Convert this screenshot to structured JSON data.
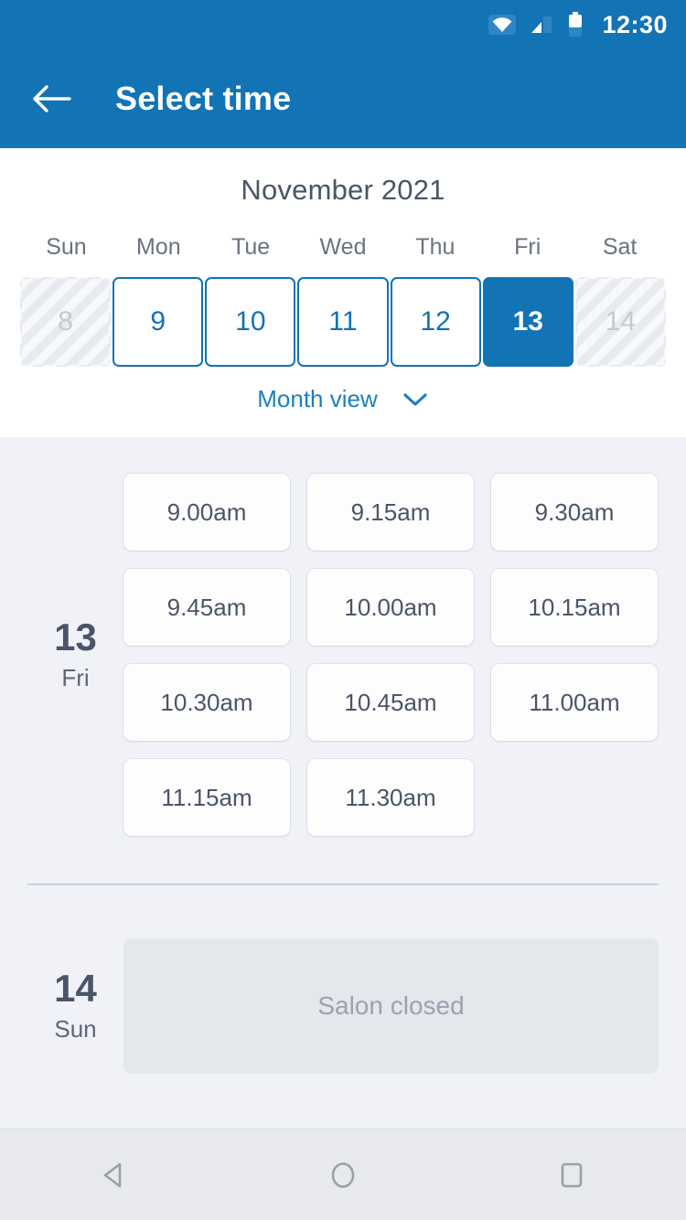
{
  "status_bar": {
    "time": "12:30",
    "icons": [
      "wifi-icon",
      "signal-icon",
      "battery-icon"
    ]
  },
  "app_bar": {
    "back_icon": "back-arrow-icon",
    "title": "Select time"
  },
  "calendar": {
    "month_title": "November 2021",
    "weekdays": [
      "Sun",
      "Mon",
      "Tue",
      "Wed",
      "Thu",
      "Fri",
      "Sat"
    ],
    "days": [
      {
        "number": "8",
        "state": "disabled"
      },
      {
        "number": "9",
        "state": "available"
      },
      {
        "number": "10",
        "state": "available"
      },
      {
        "number": "11",
        "state": "available"
      },
      {
        "number": "12",
        "state": "available"
      },
      {
        "number": "13",
        "state": "selected"
      },
      {
        "number": "14",
        "state": "disabled"
      }
    ],
    "month_view_label": "Month view",
    "month_view_icon": "chevron-down-icon"
  },
  "schedule": [
    {
      "day_number": "13",
      "day_of_week": "Fri",
      "slots": [
        "9.00am",
        "9.15am",
        "9.30am",
        "9.45am",
        "10.00am",
        "10.15am",
        "10.30am",
        "10.45am",
        "11.00am",
        "11.15am",
        "11.30am"
      ],
      "closed_message": ""
    },
    {
      "day_number": "14",
      "day_of_week": "Sun",
      "slots": [],
      "closed_message": "Salon closed"
    }
  ],
  "nav_bar": {
    "back_icon": "nav-back-triangle-icon",
    "home_icon": "nav-home-circle-icon",
    "recents_icon": "nav-recents-square-icon"
  },
  "colors": {
    "brand_blue": "#1273B5",
    "link_blue": "#1C7FBF",
    "slate_text": "#4A5568",
    "muted_text": "#6B7280",
    "slot_bg": "#F0F2F7",
    "closed_bg": "#E4E7EB"
  }
}
